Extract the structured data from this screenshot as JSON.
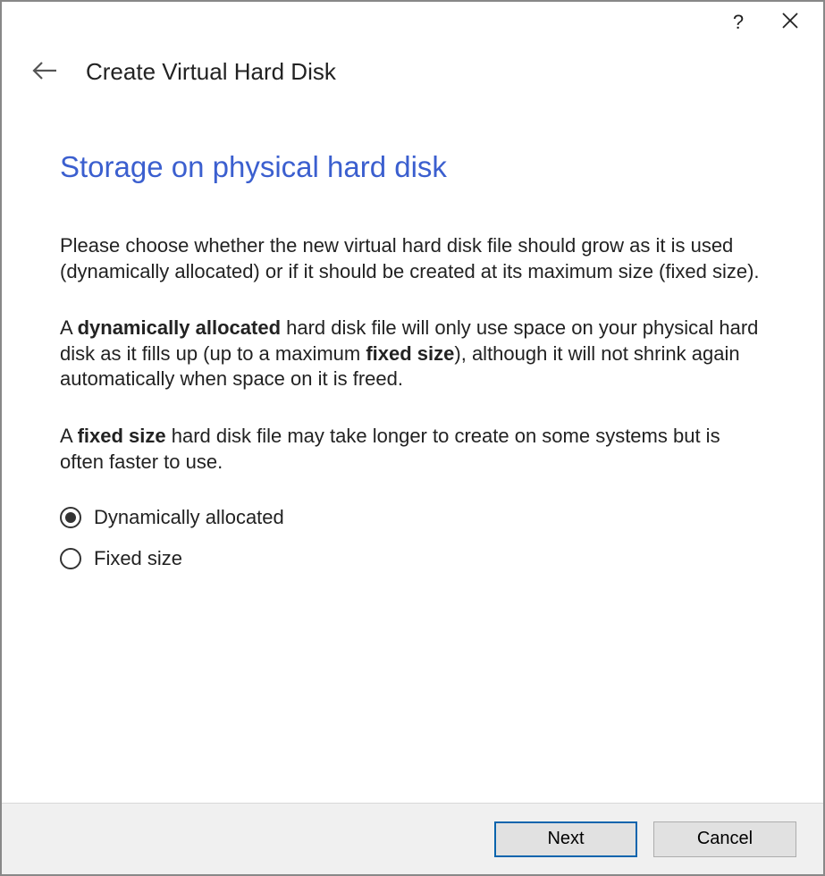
{
  "titlebar": {
    "help_tooltip": "Help",
    "close_tooltip": "Close"
  },
  "header": {
    "back_tooltip": "Back",
    "title": "Create Virtual Hard Disk"
  },
  "content": {
    "section_title": "Storage on physical hard disk",
    "paragraph1": "Please choose whether the new virtual hard disk file should grow as it is used (dynamically allocated) or if it should be created at its maximum size (fixed size).",
    "paragraph2_pre": "A ",
    "paragraph2_bold1": "dynamically allocated",
    "paragraph2_mid": " hard disk file will only use space on your physical hard disk as it fills up (up to a maximum ",
    "paragraph2_bold2": "fixed size",
    "paragraph2_post": "), although it will not shrink again automatically when space on it is freed.",
    "paragraph3_pre": "A ",
    "paragraph3_bold": "fixed size",
    "paragraph3_post": " hard disk file may take longer to create on some systems but is often faster to use.",
    "radio": {
      "option1": "Dynamically allocated",
      "option2": "Fixed size",
      "selected": "option1"
    }
  },
  "footer": {
    "next": "Next",
    "cancel": "Cancel"
  }
}
